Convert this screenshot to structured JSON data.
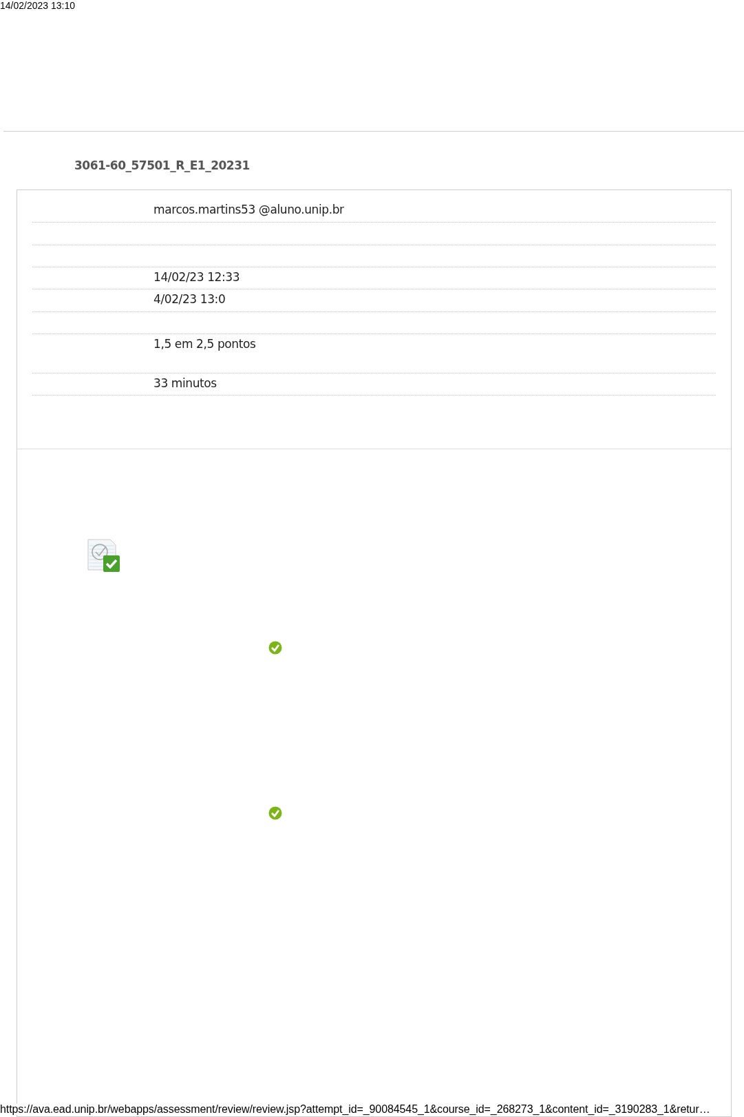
{
  "print_header": {
    "date": "14/02/2023 13:10"
  },
  "title": "3061-60_57501_R_E1_20231",
  "details": [
    {
      "value": "marcos.martins53 @aluno.unip.br"
    },
    {
      "value": "14/02/23 12:33"
    },
    {
      "value": "4/02/23 13:0"
    },
    {
      "value": "1,5 em 2,5 pontos"
    },
    {
      "value": "33 minutos"
    }
  ],
  "print_footer": {
    "url": "https://ava.ead.unip.br/webapps/assessment/review/review.jsp?attempt_id=_90084545_1&course_id=_268273_1&content_id=_3190283_1&retur…"
  }
}
